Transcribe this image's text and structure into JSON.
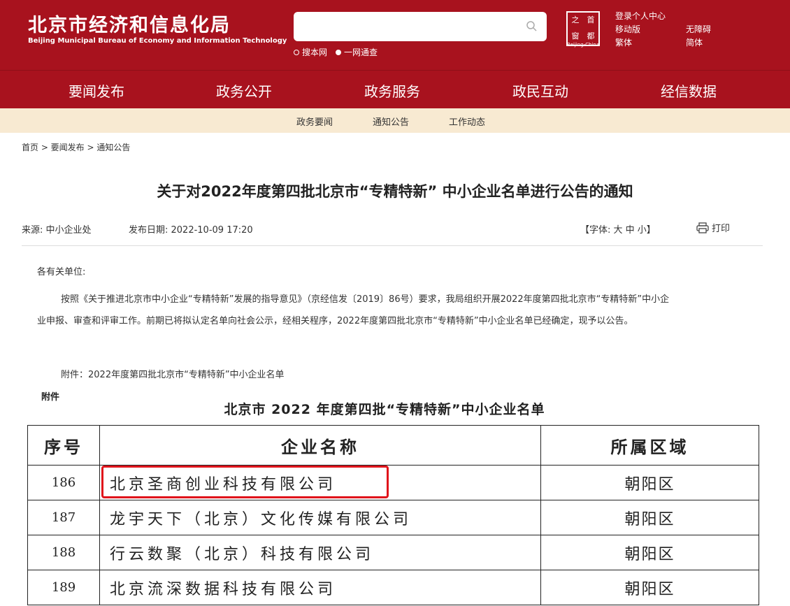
{
  "header": {
    "logo_cn": "北京市经济和信息化局",
    "logo_en": "Beijing Municipal Bureau of Economy and Information Technology",
    "search_placeholder": "",
    "radio": [
      "搜本网",
      "一网通查"
    ],
    "seal_chars": [
      "之",
      "首",
      "窗",
      "都"
    ],
    "seal_en": "Beijing-China",
    "links": {
      "login": "登录个人中心",
      "mobile": "移动版",
      "accessible": "无障碍",
      "traditional": "繁体",
      "simplified": "简体"
    }
  },
  "nav": [
    "要闻发布",
    "政务公开",
    "政务服务",
    "政民互动",
    "经信数据"
  ],
  "subnav": [
    "政务要闻",
    "通知公告",
    "工作动态"
  ],
  "breadcrumb": "首页 > 要闻发布 > 通知公告",
  "article": {
    "title": "关于对2022年度第四批北京市“专精特新” 中小企业名单进行公告的通知",
    "source": "来源:  中小企业处",
    "date": "发布日期:  2022-10-09 17:20",
    "font_size": "【字体:  大 中 小】",
    "print": "打印",
    "greeting": "各有关单位:",
    "body_line1": "按照《关于推进北京市中小企业“专精特新”发展的指导意见》（京经信发〔2019〕86号）要求，我局组织开展2022年度第四批北京市“专精特新”中小企",
    "body_line2": "业申报、审查和评审工作。前期已将拟认定名单向社会公示，经相关程序，2022年度第四批北京市“专精特新”中小企业名单已经确定，现予以公告。",
    "attachment": "附件：2022年度第四批北京市“专精特新”中小企业名单",
    "attach_label": "附件",
    "list_title": "北京市 2022 年度第四批“专精特新”中小企业名单"
  },
  "table": {
    "headers": [
      "序号",
      "企业名称",
      "所属区域"
    ],
    "rows": [
      [
        "186",
        "北京圣商创业科技有限公司",
        "朝阳区"
      ],
      [
        "187",
        "龙宇天下（北京）文化传媒有限公司",
        "朝阳区"
      ],
      [
        "188",
        "行云数聚（北京）科技有限公司",
        "朝阳区"
      ],
      [
        "189",
        "北京流深数据科技有限公司",
        "朝阳区"
      ]
    ]
  },
  "colors": {
    "brand_red": "#a8121e",
    "subnav_bg": "#f8ead2",
    "highlight": "#e0141b"
  }
}
